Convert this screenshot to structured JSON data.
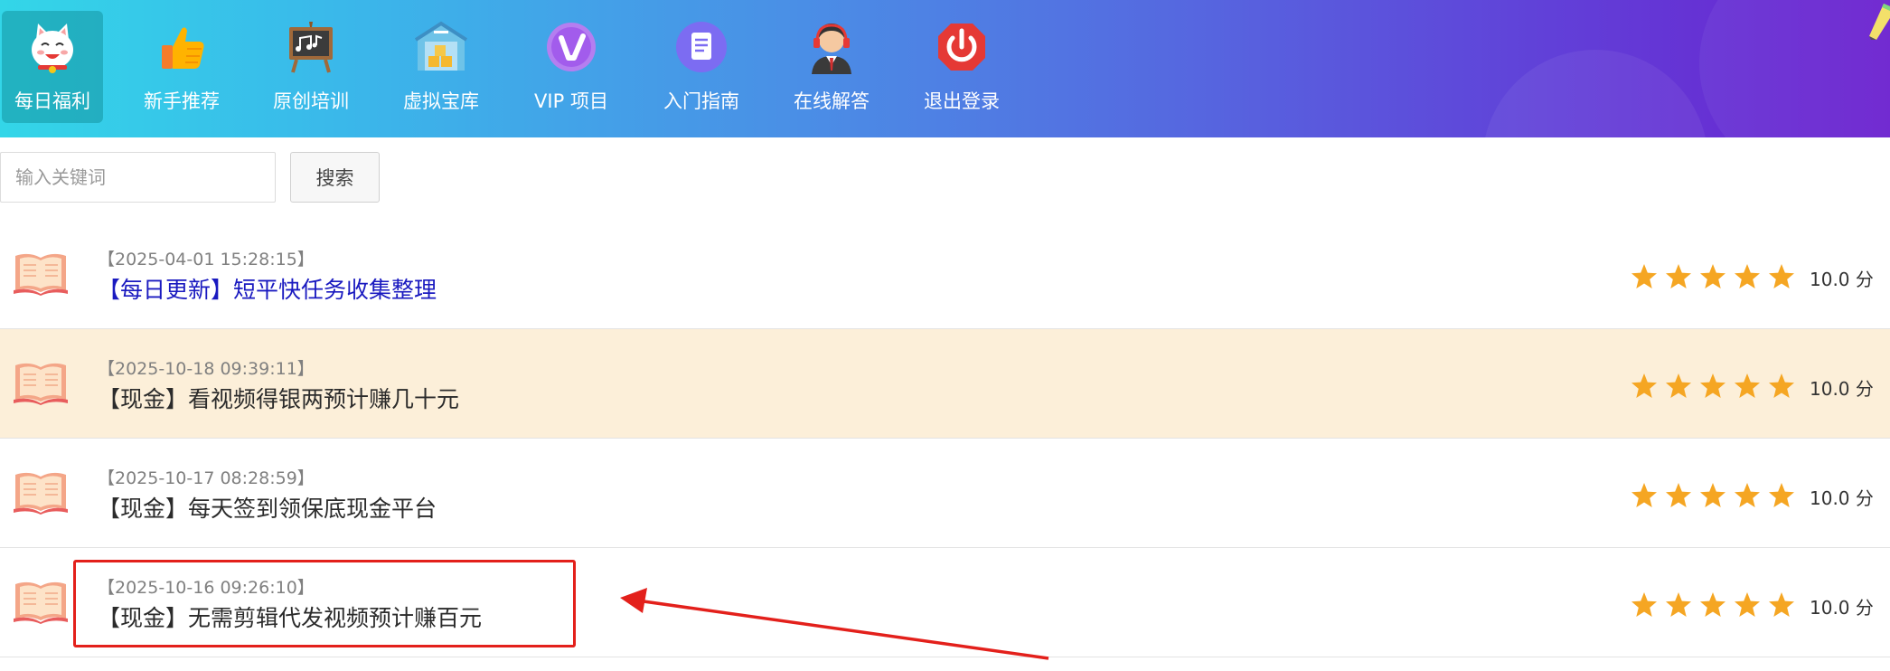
{
  "nav": {
    "items": [
      {
        "label": "每日福利",
        "icon": "lucky-cat-icon",
        "active": true
      },
      {
        "label": "新手推荐",
        "icon": "thumbs-up-icon",
        "active": false
      },
      {
        "label": "原创培训",
        "icon": "blackboard-icon",
        "active": false
      },
      {
        "label": "虚拟宝库",
        "icon": "warehouse-icon",
        "active": false
      },
      {
        "label": "VIP 项目",
        "icon": "vip-icon",
        "active": false
      },
      {
        "label": "入门指南",
        "icon": "document-icon",
        "active": false
      },
      {
        "label": "在线解答",
        "icon": "customer-service-icon",
        "active": false
      },
      {
        "label": "退出登录",
        "icon": "power-icon",
        "active": false
      }
    ]
  },
  "search": {
    "placeholder": "输入关键词",
    "value": "",
    "button_label": "搜索"
  },
  "list": {
    "items": [
      {
        "date": "【2025-04-01 15:28:15】",
        "title": "【每日更新】短平快任务收集整理",
        "stars": 5,
        "score": "10.0 分",
        "highlight": false,
        "title_color": "#1a1ac0"
      },
      {
        "date": "【2025-10-18 09:39:11】",
        "title": "【现金】看视频得银两预计赚几十元",
        "stars": 5,
        "score": "10.0 分",
        "highlight": true,
        "title_color": "#2b2b2b"
      },
      {
        "date": "【2025-10-17 08:28:59】",
        "title": "【现金】每天签到领保底现金平台",
        "stars": 5,
        "score": "10.0 分",
        "highlight": false,
        "title_color": "#2b2b2b"
      },
      {
        "date": "【2025-10-16 09:26:10】",
        "title": "【现金】无需剪辑代发视频预计赚百元",
        "stars": 5,
        "score": "10.0 分",
        "highlight": false,
        "title_color": "#2b2b2b"
      }
    ]
  },
  "colors": {
    "star": "#f5a623",
    "annotation": "#e3201b",
    "row_highlight": "#fcefd9"
  }
}
